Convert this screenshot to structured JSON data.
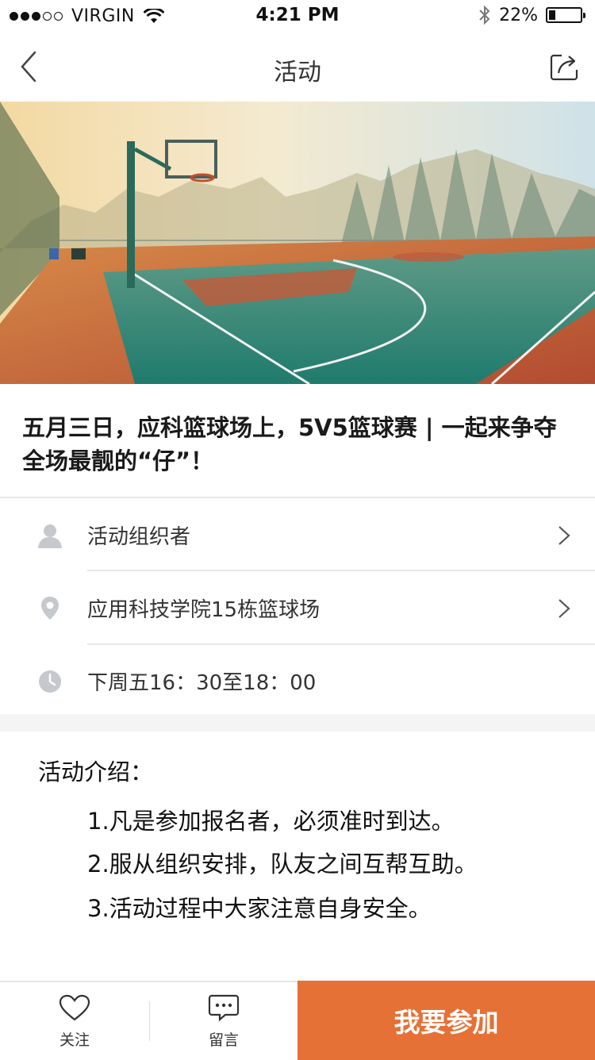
{
  "status_bar": {
    "carrier": "VIRGIN",
    "time": "4:21 PM",
    "battery": "22%",
    "battery_level": 0.22,
    "signal_bars_filled": 3,
    "signal_bars_total": 5
  },
  "nav": {
    "title": "活动",
    "back_icon": "chevron-left-icon",
    "share_icon": "share-icon"
  },
  "hero": {
    "image_subject": "basketball-court-photo"
  },
  "event": {
    "title": "五月三日，应科篮球场上，5V5篮球赛 | 一起来争夺全场最靓的“仔”！"
  },
  "info": {
    "organizer": "活动组织者",
    "location": "应用科技学院15栋篮球场",
    "time": "下周五16：30至18：00"
  },
  "intro": {
    "heading": "活动介绍：",
    "items": [
      "1.凡是参加报名者，必须准时到达。",
      "2.服从组织安排，队友之间互帮互助。",
      "3.活动过程中大家注意自身安全。"
    ]
  },
  "bottom_bar": {
    "follow_label": "关注",
    "comment_label": "留言",
    "join_label": "我要参加"
  },
  "colors": {
    "accent": "#e57136",
    "icon_gray": "#c5c8cc"
  }
}
